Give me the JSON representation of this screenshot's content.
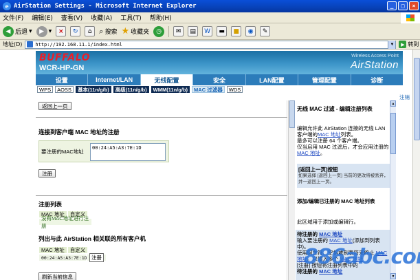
{
  "window": {
    "title": "AirStation Settings - Microsoft Internet Explorer",
    "min_label": "_",
    "max_label": "□",
    "close_label": "×"
  },
  "menu": [
    "文件(F)",
    "编辑(E)",
    "查看(V)",
    "收藏(A)",
    "工具(T)",
    "帮助(H)"
  ],
  "toolbar": {
    "back_label": "后退",
    "search_label": "搜索",
    "favorites_label": "收藏夹"
  },
  "address": {
    "label": "地址(D)",
    "url": "http://192.168.11.1/index.html",
    "go_label": "转到"
  },
  "header": {
    "brand": "BUFFALO",
    "model": "WCR-HP-GN",
    "tagline": "Wireless Access Point",
    "product": "AirStation"
  },
  "nav": [
    "设置",
    "Internet/LAN",
    "无线配置",
    "安全",
    "LAN配置",
    "管理配置",
    "诊断"
  ],
  "subnav": [
    "WPS",
    "AOSS",
    "基本(11n/g/b)",
    "高级(11n/g/b)",
    "WMM(11n/g/b)",
    "MAC 过滤器",
    "WDS"
  ],
  "logout_label": "注销",
  "main": {
    "back_button": "返回上一页",
    "register_title": "连接到客户端  MAC 地址的注册",
    "mac_label": "要注册的MAC地址",
    "mac_value": "00:24:A5:A3:7E:1D",
    "register_button": "注册",
    "list_title": "注册列表",
    "col_mac": "MAC 地址",
    "col_custom": "自定义",
    "empty_text": "没有MAC地址进行注册",
    "clients_title": "列出与此  AirStation 相关联的所有客户机",
    "client_mac": "00:24:A5:A3:7E:1D",
    "client_register_button": "注册",
    "refresh_button": "刷新当前信息"
  },
  "help": {
    "title": "无线 MAC 过滤 - 编辑注册列表",
    "p1_a": "编辑允许此 AirStation 连接的无线 LAN 客户端的",
    "p1_link": "MAC 地址",
    "p1_b": "列表。",
    "p2": "最多可以注册 64 个客户端。",
    "p3_a": "仅当启用 MAC 过滤后，才会应用注册的",
    "p3_link": "MAC 地址",
    "p3_b": "。",
    "back_h": "[返回上一页]按钮",
    "back_t": "如果选择 [返回上一页] 当前的更改将被丢弃，并一返回上一页。",
    "edit_h": "添加/编辑已注册的 MAC 地址列表",
    "edit_t": "此区域用于添加或编辑行。",
    "reg_h_a": "待注册的",
    "reg_h_link": "MAC 地址",
    "reg_t_a": "输入要注册的",
    "reg_t_link": "MAC 地址",
    "reg_t_b": "(添加到列表中)。",
    "reg_t2": "使用回车符、空格或制表符来终止",
    "reg_t2_link": "MAC 地址",
    "reg_t2_b": "。以输入多个",
    "reg_t3_link": "MAC 地址",
    "reg_t4": "[注册] 按钮将注册列表中的",
    "reg_t5": "待注册的",
    "reg_t5_link": "MAC 地址"
  },
  "watermark": "886abc.com"
}
